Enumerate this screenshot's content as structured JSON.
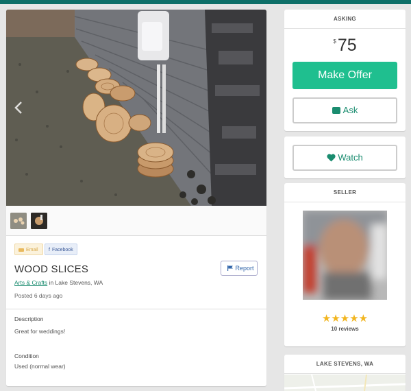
{
  "colors": {
    "brand": "#1fbf8f",
    "link": "#1a8c6f",
    "star": "#f2b51f",
    "topbar": "#0e6f68"
  },
  "listing": {
    "share": {
      "email": "Email",
      "facebook": "Facebook"
    },
    "title": "WOOD SLICES",
    "report_label": "Report",
    "category": "Arts & Crafts",
    "location_text": "in Lake Stevens, WA",
    "posted": "Posted 6 days ago",
    "description_label": "Description",
    "description": "Great for weddings!",
    "condition_label": "Condition",
    "condition": "Used (normal wear)"
  },
  "asking": {
    "header": "ASKING",
    "currency": "$",
    "price": "75",
    "make_offer": "Make Offer",
    "ask": "Ask"
  },
  "watch": {
    "label": "Watch"
  },
  "seller": {
    "header": "SELLER",
    "stars": "★★★★★",
    "rating": 5,
    "reviews": "10 reviews"
  },
  "location": {
    "header": "LAKE STEVENS, WA"
  },
  "icons": [
    "chevron-left-icon",
    "envelope-icon",
    "facebook-icon",
    "flag-icon",
    "chat-bubble-icon",
    "heart-icon",
    "star-icon"
  ]
}
